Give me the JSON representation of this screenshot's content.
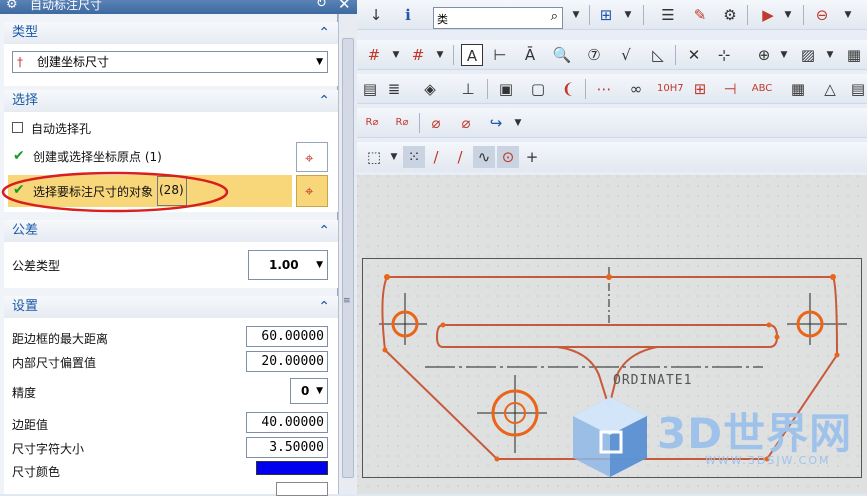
{
  "dialog": {
    "title": "自动标注尺寸",
    "type_section": {
      "header": "类型",
      "dropdown_value": "创建坐标尺寸"
    },
    "select_section": {
      "header": "选择",
      "auto_hole_label": "自动选择孔",
      "origin_label": "创建或选择坐标原点 (1)",
      "objects_label": "选择要标注尺寸的对象",
      "objects_count": "(28)"
    },
    "tolerance_section": {
      "header": "公差",
      "tol_type_label": "公差类型",
      "tol_type_value": "1.00"
    },
    "settings_section": {
      "header": "设置",
      "max_dist_label": "距边框的最大距离",
      "max_dist_value": "60.00000",
      "inner_offset_label": "内部尺寸偏置值",
      "inner_offset_value": "20.00000",
      "precision_label": "精度",
      "precision_value": "0",
      "margin_label": "边距值",
      "margin_value": "40.00000",
      "char_size_label": "尺寸字符大小",
      "char_size_value": "3.50000",
      "dim_color_label": "尺寸颜色",
      "dim_color": "#0000ee"
    }
  },
  "toolbar": {
    "search_value": "类"
  },
  "drawing": {
    "ordinate_label": "ORDINATE1",
    "accent": "#e8651a"
  },
  "watermark": {
    "text": "3D世界网",
    "url": "WWW.3DSJW.COM"
  }
}
